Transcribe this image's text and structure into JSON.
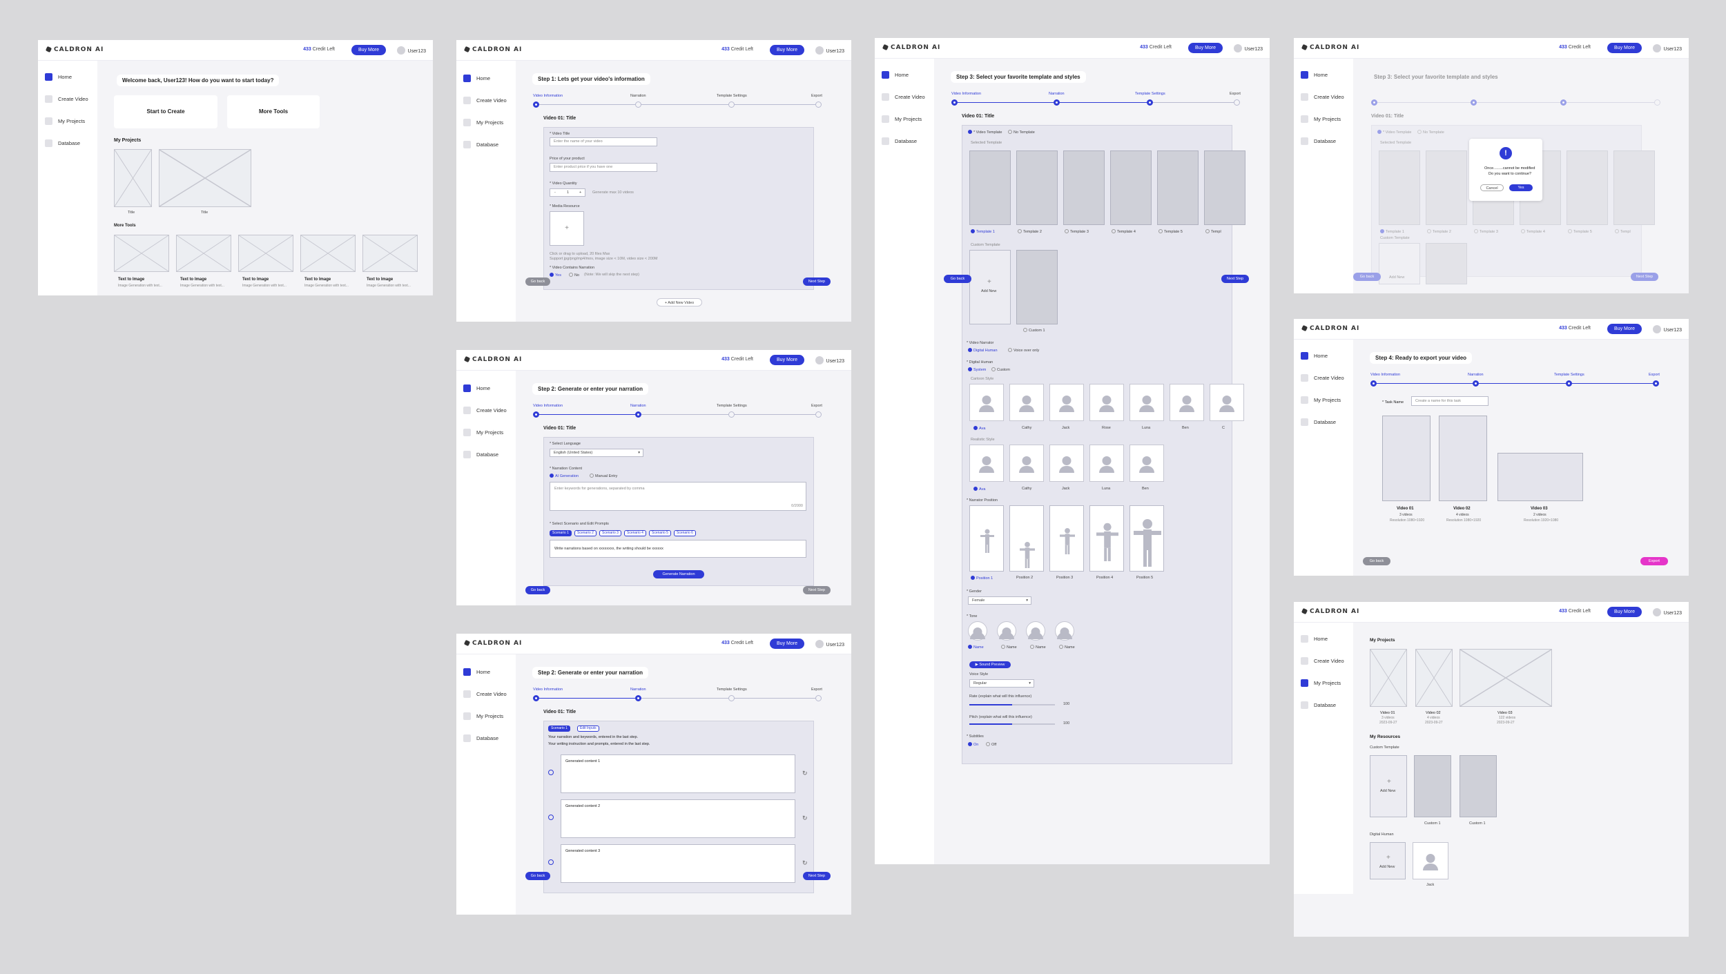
{
  "header": {
    "logo": "CALDRON AI",
    "credit_count": "433",
    "credit_label": "Credit Left",
    "buy_label": "Buy More",
    "user": "User123"
  },
  "nav": [
    "Home",
    "Create Video",
    "My Projects",
    "Database"
  ],
  "home": {
    "welcome": "Welcome back, User123!  How do you want to start today?",
    "start_create": "Start to Create",
    "more_tools_btn": "More Tools",
    "my_projects": "My Projects",
    "project_titles": [
      "Title",
      "Title"
    ],
    "more_tools": "More Tools",
    "tool_title": "Text to Image",
    "tool_desc": "Image Generation with text..."
  },
  "steps": {
    "labels": [
      "Video Information",
      "Narration",
      "Template Settings",
      "Export"
    ],
    "template_label": "Template  Settings"
  },
  "step1": {
    "title": "Step 1: Lets get your video's information",
    "video": "Video 01: Title",
    "video_title": "* Video Title",
    "video_title_ph": "Enter the name of your video",
    "price": "Price of your product",
    "price_ph": "Enter product price if you have one",
    "quantity": "* Video Quantity",
    "qty_minus": "-",
    "qty_val": "1",
    "qty_plus": "+",
    "qty_note": "Generate max 10 videos",
    "media": "* Media Resource",
    "upload_plus": "+",
    "upload_note1": "Click or drag to upload, 20 files Max",
    "upload_note2": "Support jpg/png/mp4/mov, image size < 10M, video size < 200M",
    "narr_q": "* Video Contains Narration",
    "yes": "Yes",
    "no": "No",
    "no_note": "(Note: We will skip the next step)",
    "go_back": "Go back",
    "next": "Next Step",
    "add_video": "+ Add New Video"
  },
  "step2a": {
    "title": "Step 2: Generate or enter your narration",
    "video": "Video 01: Title",
    "lang": "* Select Language",
    "lang_val": "English (United States)",
    "content": "* Narration Content",
    "ai": "AI Generation",
    "manual": "Manual Entry",
    "kw_ph": "Enter keywords for generations, separated by comma",
    "count": "0/2000",
    "scen": "* Select Scenario and Edit Prompts",
    "scenarios": [
      "Scenario 1",
      "Scenario 2",
      "Scenario 3",
      "Scenario 4",
      "Scenario 5",
      "Scenario 6"
    ],
    "prompt": "Write narrations based on xxxxxxxx, the writing should be xxxxxx",
    "gen": "Generate Narration",
    "go_back": "Go back",
    "next": "Next Step"
  },
  "step2b": {
    "title": "Step 2: Generate or enter your narration",
    "video": "Video 01: Title",
    "scen": "Scenario 1",
    "edit": "Edit Inputs",
    "line1": "Your narration and keywords, entered in the last step.",
    "line2": "Your writing instruction and prompts, entered in the last step.",
    "contents": [
      "Generated content 1",
      "Generated content 2",
      "Generated content 3"
    ],
    "go_back": "Go back",
    "next": "Next Step"
  },
  "step3": {
    "title": "Step 3: Select your favorite template and styles",
    "video": "Video 01: Title",
    "vt": "* Video Template",
    "no_tpl": "No Template",
    "selected": "Selected Template",
    "templates": [
      "Template 1",
      "Template 2",
      "Template 3",
      "Template 4",
      "Template 5",
      "Templ"
    ],
    "custom": "Custom Template",
    "add_new": "Add New",
    "custom1": "Custom 1",
    "narrator": "* Video Narrator",
    "dh_opt": "Digital Human",
    "vo_opt": "Voice over only",
    "dh": "* Digital Human",
    "system": "System",
    "custom_opt": "Custom",
    "cartoon": "Cartoon Style",
    "cartoon_names": [
      "Ava",
      "Cathy",
      "Jack",
      "Rose",
      "Luna",
      "Ben",
      "C"
    ],
    "realistic": "Realistic Style",
    "real_names": [
      "Ava",
      "Cathy",
      "Jack",
      "Luna",
      "Ben"
    ],
    "pos": "* Narrator Position",
    "positions": [
      "Position 1",
      "Position 2",
      "Position 3",
      "Position 4",
      "Position 5"
    ],
    "gender": "* Gender",
    "gender_val": "Female",
    "tone": "* Tone",
    "tone_names": [
      "Name",
      "Name",
      "Name",
      "Name"
    ],
    "preview": "Sound Preview",
    "vstyle": "Voice Style",
    "vstyle_val": "Regular",
    "rate": "Rate (explain what will this influence)",
    "rate_val": "100",
    "pitch": "Pitch (explain what will this influence)",
    "pitch_val": "100",
    "subs": "* Subtitles",
    "on": "On",
    "off": "Off",
    "go_back": "Go back",
    "next": "Next Step"
  },
  "modal": {
    "title": "Step 3: Select your favorite template and styles",
    "warn1": "Once.........cannot be modified",
    "warn2": "Do you want to continue?",
    "cancel": "Cancel",
    "yes": "Yes",
    "video": "Video 01: Title",
    "vt": "* Video Template",
    "no_tpl": "No Template",
    "selected": "Selected Template",
    "templates": [
      "Template 1",
      "Template 2",
      "Template 3",
      "Template 4",
      "Template 5",
      "Templ"
    ],
    "custom": "Custom Template",
    "add": "Add New",
    "go_back": "Go back",
    "next": "Next Step"
  },
  "step4": {
    "title": "Step 4: Ready to export your video",
    "task": "* Task Name",
    "task_ph": "Create a name for this task",
    "videos": [
      {
        "t": "Video 01",
        "n": "3 videos",
        "r": "Resolution 1080×1920"
      },
      {
        "t": "Video 02",
        "n": "4 videos",
        "r": "Resolution 1080×1920"
      },
      {
        "t": "Video 03",
        "n": "2 videos",
        "r": "Resolution 1920×1080"
      }
    ],
    "go_back": "Go back",
    "export": "Export"
  },
  "projects": {
    "my_projects": "My Projects",
    "items": [
      {
        "t": "Video 01",
        "n": "3 videos",
        "d": "2023-09-27"
      },
      {
        "t": "Video 02",
        "n": "4 videos",
        "d": "2023-09-27"
      },
      {
        "t": "Video 03",
        "n": "122 videos",
        "d": "2023-09-27"
      }
    ],
    "resources": "My Resources",
    "custom_tpl": "Custom Template",
    "add": "Add New",
    "custom": [
      "Custom 1",
      "Custom 1"
    ],
    "dh": "Digital Human",
    "jack": "Jack"
  }
}
